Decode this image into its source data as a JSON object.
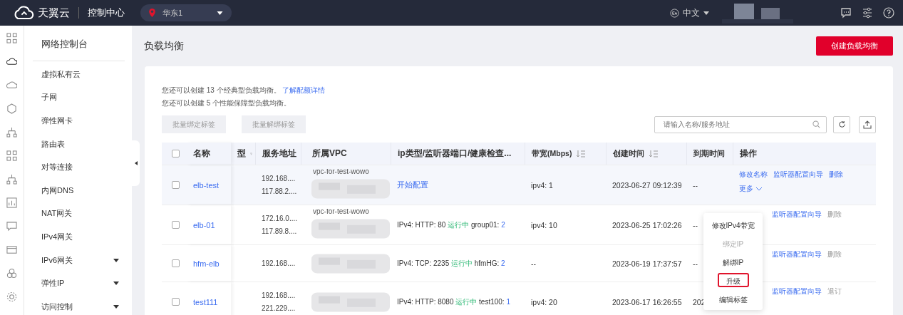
{
  "topbar": {
    "brand": "天翼云",
    "console": "控制中心",
    "region": "华东1",
    "language": "中文"
  },
  "sidebar": {
    "title": "网络控制台",
    "items": [
      {
        "label": "虚拟私有云",
        "expandable": false
      },
      {
        "label": "子网",
        "expandable": false
      },
      {
        "label": "弹性网卡",
        "expandable": false
      },
      {
        "label": "路由表",
        "expandable": false
      },
      {
        "label": "对等连接",
        "expandable": false
      },
      {
        "label": "内网DNS",
        "expandable": false
      },
      {
        "label": "NAT网关",
        "expandable": false
      },
      {
        "label": "IPv4网关",
        "expandable": false
      },
      {
        "label": "IPv6网关",
        "expandable": true
      },
      {
        "label": "弹性IP",
        "expandable": true
      },
      {
        "label": "访问控制",
        "expandable": true
      }
    ]
  },
  "page": {
    "title": "负载均衡",
    "create_button": "创建负载均衡",
    "notices": [
      {
        "text": "您还可以创建 13 个经典型负载均衡。",
        "link": "了解配额详情"
      },
      {
        "text": "您还可以创建 5 个性能保障型负载均衡。"
      }
    ],
    "batch_buttons": [
      {
        "label": "批量绑定标签",
        "disabled": true
      },
      {
        "label": "批量解绑标签",
        "disabled": true
      }
    ],
    "search": {
      "placeholder": "请输入名称/服务地址"
    }
  },
  "table": {
    "select_all_checked": false,
    "columns": [
      {
        "label": "名称",
        "sortable": false,
        "filter": false
      },
      {
        "label": "型",
        "sortable": false,
        "filter": true
      },
      {
        "label": "服务地址",
        "sortable": false,
        "filter": false
      },
      {
        "label": "所属VPC",
        "sortable": false,
        "filter": false
      },
      {
        "label": "ip类型/监听器端口/健康检查...",
        "sortable": false,
        "filter": false
      },
      {
        "label": "带宽(Mbps)",
        "sortable": true,
        "filter": false
      },
      {
        "label": "创建时间",
        "sortable": true,
        "filter": false
      },
      {
        "label": "到期时间",
        "sortable": false,
        "filter": false
      },
      {
        "label": "操作",
        "sortable": false,
        "filter": false
      }
    ],
    "rows": [
      {
        "name": "elb-test",
        "checked": false,
        "highlighted": true,
        "addresses": [
          "192.168....",
          "117.88.2...."
        ],
        "vpc": "vpc-for-test-wowo",
        "listener": {
          "kind": "link",
          "text": "开始配置"
        },
        "bandwidth": "ipv4: 1",
        "created": "2023-06-27 09:12:39",
        "expiry": "--",
        "actions": [
          {
            "label": "修改名称",
            "disabled": false
          },
          {
            "label": "监听器配置向导",
            "disabled": false
          },
          {
            "label": "删除",
            "disabled": false
          }
        ],
        "more": "更多"
      },
      {
        "name": "elb-01",
        "checked": false,
        "highlighted": false,
        "addresses": [
          "172.16.0....",
          "117.89.8...."
        ],
        "vpc": "vpc-for-test-wowo",
        "listener": {
          "kind": "status",
          "text": "IPv4: HTTP: 80",
          "status": "运行中",
          "group": "group01:",
          "count": "2"
        },
        "bandwidth": "ipv4: 10",
        "created": "2023-06-25 17:02:26",
        "expiry": "--",
        "actions": [
          {
            "label": "监听器配置向导",
            "disabled": false
          },
          {
            "label": "删除",
            "disabled": true
          }
        ]
      },
      {
        "name": "hfm-elb",
        "checked": false,
        "highlighted": false,
        "addresses": [
          "192.168...."
        ],
        "listener": {
          "kind": "status",
          "text": "IPv4: TCP: 2235",
          "status": "运行中",
          "group": "hfmHG:",
          "count": "2"
        },
        "bandwidth": "--",
        "created": "2023-06-19 17:37:57",
        "expiry": "--",
        "actions": [
          {
            "label": "监听器配置向导",
            "disabled": false
          },
          {
            "label": "删除",
            "disabled": true
          }
        ]
      },
      {
        "name": "test111",
        "checked": false,
        "highlighted": false,
        "addresses": [
          "192.168....",
          "221.229...."
        ],
        "listener": {
          "kind": "status",
          "text": "IPv4: HTTP: 8080",
          "status": "运行中",
          "group": "test100:",
          "count": "1"
        },
        "bandwidth": "ipv4: 20",
        "created": "2023-06-17 16:26:55",
        "expiry": "202",
        "actions": [
          {
            "label": "监听器配置向导",
            "disabled": false
          },
          {
            "label": "退订",
            "disabled": true
          }
        ]
      }
    ]
  },
  "more_menu": {
    "items": [
      {
        "label": "修改IPv4带宽",
        "disabled": false,
        "highlighted": false
      },
      {
        "label": "绑定IP",
        "disabled": true,
        "highlighted": false
      },
      {
        "label": "解绑IP",
        "disabled": false,
        "highlighted": false
      },
      {
        "label": "升级",
        "disabled": false,
        "highlighted": true
      },
      {
        "label": "编辑标签",
        "disabled": false,
        "highlighted": false
      }
    ]
  }
}
